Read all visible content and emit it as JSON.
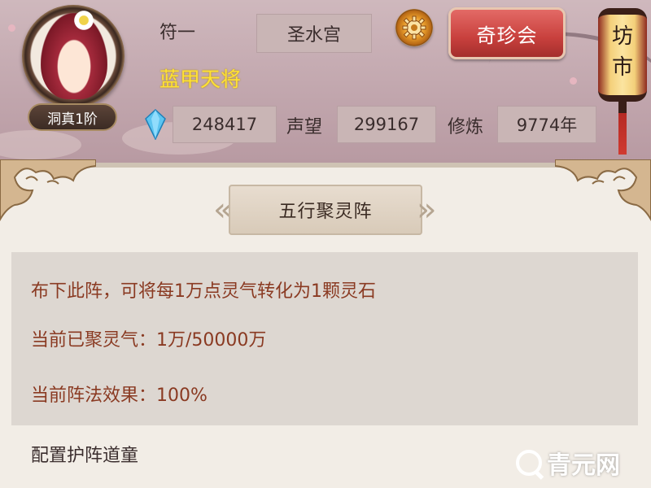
{
  "header": {
    "avatar_rank": "洞真1阶",
    "player_name": "符一",
    "server_name": "圣水宫",
    "treasure_button": "奇珍会",
    "market_sign": [
      "坊",
      "市"
    ],
    "title": "蓝甲天将",
    "stats": {
      "spirit_stones": "248417",
      "reputation_label": "声望",
      "reputation": "299167",
      "cultivation_label": "修炼",
      "cultivation": "9774年"
    }
  },
  "panel": {
    "title": "五行聚灵阵",
    "lines": [
      "布下此阵，可将每1万点灵气转化为1颗灵石",
      "当前已聚灵气：1万/50000万",
      "当前阵法效果：100%"
    ],
    "config_label": "配置护阵道童"
  },
  "watermark": {
    "text": "青元网"
  },
  "icons": {
    "settings": "gear-icon",
    "gem": "gem-icon",
    "lantern": "lantern-icon"
  },
  "colors": {
    "title_yellow": "#ffe234",
    "button_red": "#c8403d",
    "info_text": "#8a3a22",
    "header_bg": "#c2a7ae"
  }
}
